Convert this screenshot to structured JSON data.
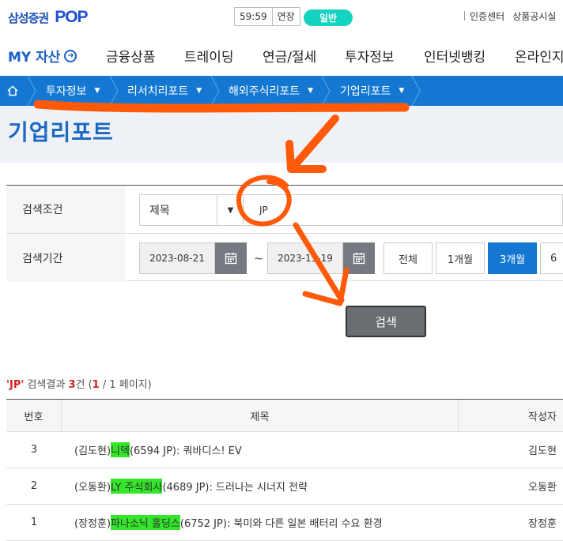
{
  "header": {
    "logo_text": "삼성증권",
    "logo_pop": "POP",
    "timer": "59:59",
    "extend_label": "연장",
    "mode_badge": "일반",
    "util_links": [
      "인증센터",
      "상품공시실"
    ]
  },
  "main_nav": {
    "my_assets": "MY 자산",
    "items": [
      "금융상품",
      "트레이딩",
      "연금/절세",
      "투자정보",
      "인터넷뱅킹",
      "온라인지"
    ]
  },
  "breadcrumb": [
    "투자정보",
    "리서치리포트",
    "해외주식리포트",
    "기업리포트"
  ],
  "page_title": "기업리포트",
  "search": {
    "condition_label": "검색조건",
    "condition_select": "제목",
    "keyword": "JP",
    "period_label": "검색기간",
    "date_from": "2023-08-21",
    "date_to": "2023-11-19",
    "tilde": "~",
    "ranges": [
      "전체",
      "1개월",
      "3개월",
      "6"
    ],
    "active_range": "3개월",
    "submit_label": "검색"
  },
  "results": {
    "keyword_quoted": "'JP'",
    "summary_text": " 검색결과 ",
    "count": "3",
    "count_unit": "건 (",
    "page_current": "1",
    "page_rest": " / 1 페이지)",
    "columns": [
      "번호",
      "제목",
      "작성자"
    ],
    "rows": [
      {
        "no": "3",
        "pre": "(김도현) ",
        "hl": "니덱",
        "post": "(6594 JP): 쿼바디스! EV",
        "author": "김도현"
      },
      {
        "no": "2",
        "pre": "(오동환)",
        "hl": "LY 주식회사",
        "post": "(4689 JP): 드러나는 시너지 전략",
        "author": "오동환"
      },
      {
        "no": "1",
        "pre": "(장정훈) ",
        "hl": "파나소닉 홀딩스",
        "post": " (6752 JP): 북미와 다른 일본 배터리 수요 환경",
        "author": "장정훈"
      }
    ]
  },
  "colors": {
    "brand_blue": "#1478d3",
    "title_blue": "#1d68c0",
    "badge_teal": "#14d4c0",
    "highlight_green": "#33e62a",
    "annotation_orange": "#ff5a0a"
  }
}
